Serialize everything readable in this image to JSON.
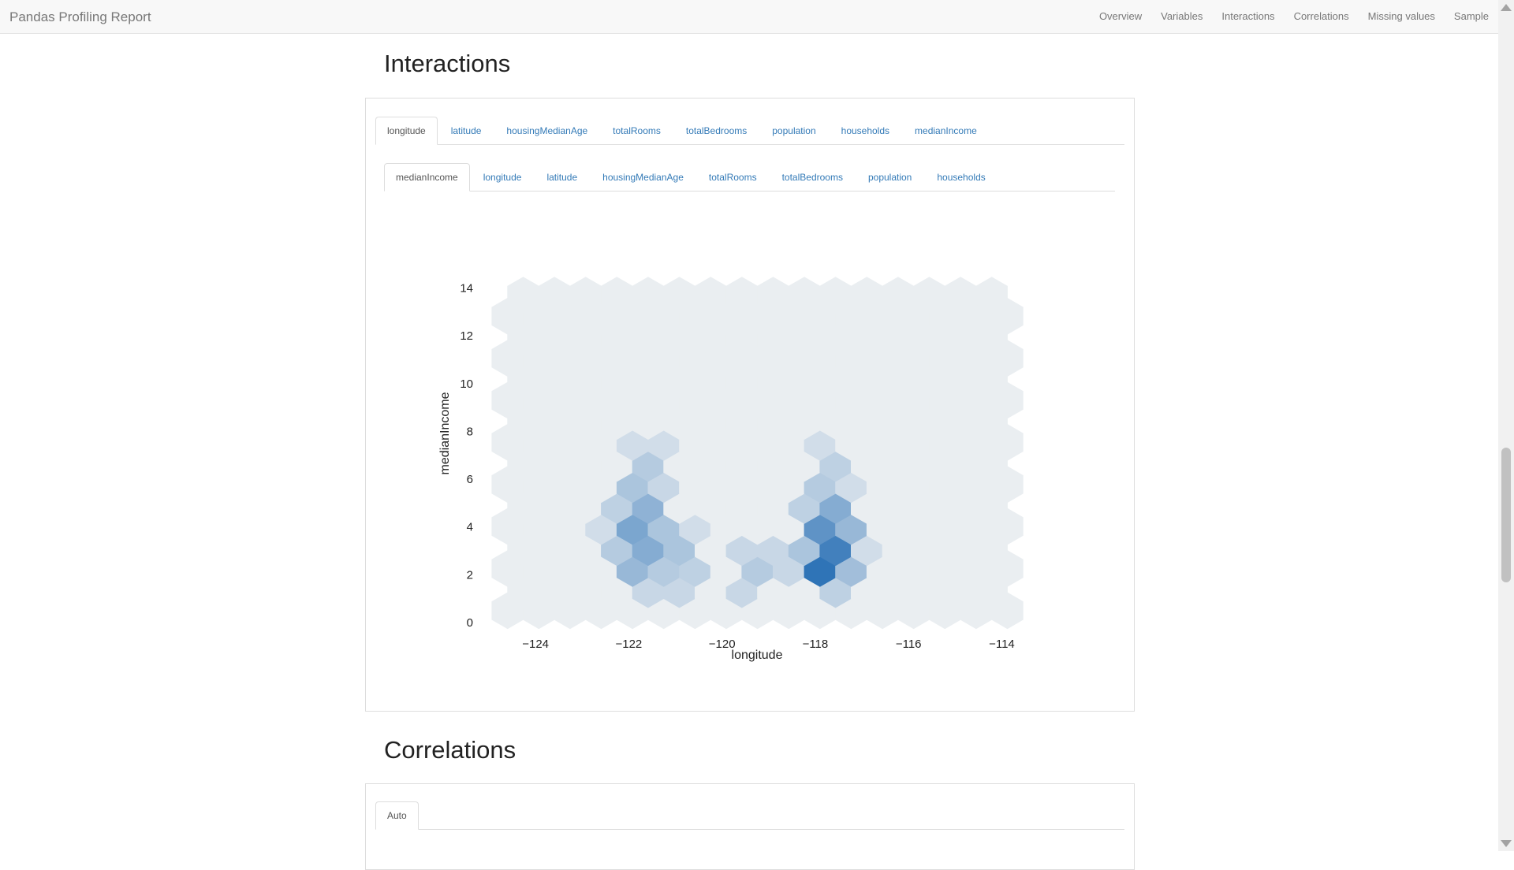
{
  "navbar": {
    "brand": "Pandas Profiling Report",
    "links": [
      "Overview",
      "Variables",
      "Interactions",
      "Correlations",
      "Missing values",
      "Sample"
    ]
  },
  "interactions": {
    "title": "Interactions",
    "outer_tabs": [
      "longitude",
      "latitude",
      "housingMedianAge",
      "totalRooms",
      "totalBedrooms",
      "population",
      "households",
      "medianIncome"
    ],
    "outer_active": "longitude",
    "inner_tabs": [
      "medianIncome",
      "longitude",
      "latitude",
      "housingMedianAge",
      "totalRooms",
      "totalBedrooms",
      "population",
      "households"
    ],
    "inner_active": "medianIncome"
  },
  "correlations": {
    "title": "Correlations",
    "tabs": [
      "Auto"
    ],
    "active": "Auto"
  },
  "colors": {
    "accent": "#337ab7",
    "hex_low": "#eef0f2",
    "hex_high": "#2f74b7"
  },
  "chart_data": {
    "type": "heatmap",
    "subtype": "hexbin",
    "xlabel": "longitude",
    "ylabel": "medianIncome",
    "xlim": [
      -125,
      -113.5
    ],
    "ylim": [
      0,
      15.5
    ],
    "xticks": [
      -124,
      -122,
      -120,
      -118,
      -116,
      -114
    ],
    "xtick_labels": [
      "−124",
      "−122",
      "−120",
      "−118",
      "−116",
      "−114"
    ],
    "yticks": [
      0,
      2,
      4,
      6,
      8,
      10,
      12,
      14
    ],
    "ytick_labels": [
      "0",
      "2",
      "4",
      "6",
      "8",
      "10",
      "12",
      "14"
    ],
    "bins": {
      "x_start": -124.6,
      "x_step": 0.67,
      "y_start": 0.5,
      "y_step": 0.88,
      "x_count": 17,
      "y_count": 16
    },
    "hot_cells": [
      {
        "x": -118.0,
        "y": 2.1,
        "v": 1.0
      },
      {
        "x": -117.7,
        "y": 3.0,
        "v": 0.9
      },
      {
        "x": -118.0,
        "y": 3.9,
        "v": 0.75
      },
      {
        "x": -117.7,
        "y": 4.8,
        "v": 0.55
      },
      {
        "x": -117.3,
        "y": 3.9,
        "v": 0.45
      },
      {
        "x": -117.0,
        "y": 2.1,
        "v": 0.4
      },
      {
        "x": -117.3,
        "y": 3.0,
        "v": 0.4
      },
      {
        "x": -118.3,
        "y": 3.0,
        "v": 0.35
      },
      {
        "x": -117.7,
        "y": 6.5,
        "v": 0.25
      },
      {
        "x": -118.0,
        "y": 5.7,
        "v": 0.3
      },
      {
        "x": -117.7,
        "y": 1.3,
        "v": 0.25
      },
      {
        "x": -118.3,
        "y": 4.8,
        "v": 0.25
      },
      {
        "x": -117.0,
        "y": 3.9,
        "v": 0.25
      },
      {
        "x": -121.9,
        "y": 3.9,
        "v": 0.6
      },
      {
        "x": -121.6,
        "y": 3.0,
        "v": 0.55
      },
      {
        "x": -121.6,
        "y": 4.8,
        "v": 0.5
      },
      {
        "x": -121.9,
        "y": 2.1,
        "v": 0.45
      },
      {
        "x": -121.3,
        "y": 3.9,
        "v": 0.35
      },
      {
        "x": -121.9,
        "y": 5.7,
        "v": 0.35
      },
      {
        "x": -121.0,
        "y": 3.0,
        "v": 0.35
      },
      {
        "x": -121.3,
        "y": 2.1,
        "v": 0.3
      },
      {
        "x": -122.2,
        "y": 3.0,
        "v": 0.3
      },
      {
        "x": -121.6,
        "y": 6.5,
        "v": 0.3
      },
      {
        "x": -122.2,
        "y": 4.8,
        "v": 0.25
      },
      {
        "x": -120.6,
        "y": 2.1,
        "v": 0.25
      },
      {
        "x": -119.3,
        "y": 2.1,
        "v": 0.3
      },
      {
        "x": -119.6,
        "y": 3.0,
        "v": 0.2
      },
      {
        "x": -119.0,
        "y": 3.0,
        "v": 0.2
      },
      {
        "x": -119.6,
        "y": 1.3,
        "v": 0.2
      },
      {
        "x": -118.6,
        "y": 2.1,
        "v": 0.2
      },
      {
        "x": -121.3,
        "y": 1.3,
        "v": 0.2
      },
      {
        "x": -121.3,
        "y": 5.7,
        "v": 0.2
      },
      {
        "x": -120.6,
        "y": 3.9,
        "v": 0.15
      },
      {
        "x": -122.5,
        "y": 3.9,
        "v": 0.15
      },
      {
        "x": -121.6,
        "y": 7.4,
        "v": 0.15
      },
      {
        "x": -118.0,
        "y": 7.4,
        "v": 0.15
      },
      {
        "x": -117.3,
        "y": 5.7,
        "v": 0.15
      },
      {
        "x": -116.7,
        "y": 3.0,
        "v": 0.15
      }
    ]
  }
}
